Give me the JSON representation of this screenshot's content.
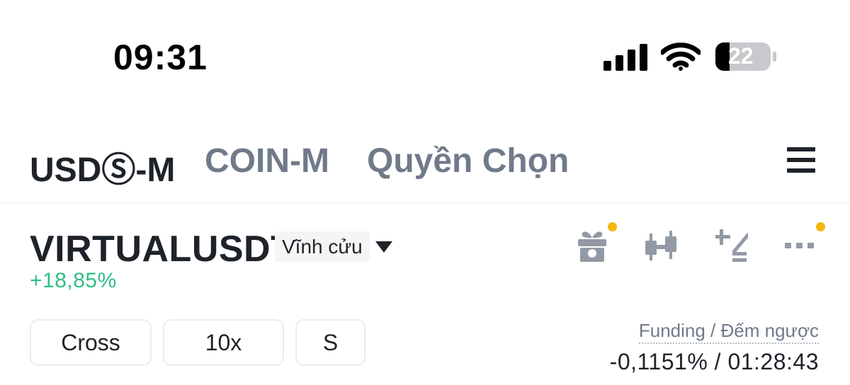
{
  "status_bar": {
    "time": "09:31",
    "battery_level": "22"
  },
  "tabs": [
    {
      "label": "USDⓈ-M",
      "active": true
    },
    {
      "label": "COIN-M",
      "active": false
    },
    {
      "label": "Quyền Chọn",
      "active": false
    }
  ],
  "symbol": {
    "name": "VIRTUALUSDT",
    "contract_type": "Vĩnh cửu",
    "change": "+18,85%"
  },
  "toolbar": {
    "icons": [
      "gift-icon",
      "candlestick-icon",
      "calculator-icon",
      "more-icon"
    ]
  },
  "order_settings": {
    "margin_mode": "Cross",
    "leverage": "10x",
    "position_mode": "S"
  },
  "funding": {
    "label": "Funding / Đếm ngược",
    "value": "-0,1151% / 01:28:43"
  },
  "colors": {
    "positive": "#2ebd85",
    "accent_dot": "#f0b90b",
    "text_primary": "#1e2329",
    "text_secondary": "#707a8a"
  }
}
